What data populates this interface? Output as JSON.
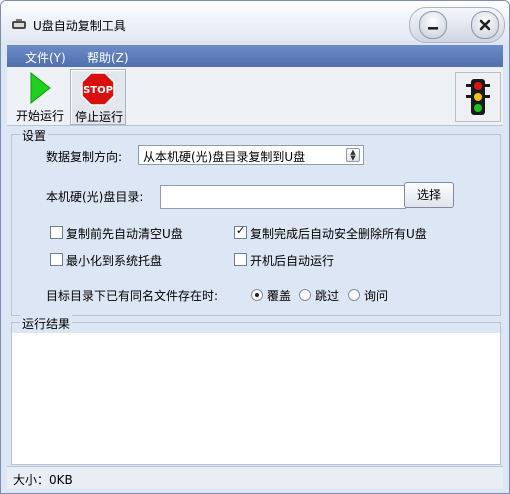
{
  "window": {
    "title": "U盘自动复制工具"
  },
  "menu": {
    "file": "文件(Y)",
    "help": "帮助(Z)"
  },
  "toolbar": {
    "start_label": "开始运行",
    "stop_label": "停止运行",
    "stop_sign_text": "STOP"
  },
  "settings": {
    "group_title": "设置",
    "direction_label": "数据复制方向:",
    "direction_value": "从本机硬(光)盘目录复制到U盘",
    "dir_label": "本机硬(光)盘目录:",
    "dir_value": "",
    "browse_button": "选择",
    "options": [
      {
        "label": "复制前先自动清空U盘",
        "checked": false
      },
      {
        "label": "复制完成后自动安全删除所有U盘",
        "checked": true
      },
      {
        "label": "最小化到系统托盘",
        "checked": false
      },
      {
        "label": "开机后自动运行",
        "checked": false
      }
    ],
    "conflict_label": "目标目录下已有同名文件存在时:",
    "conflict_options": [
      {
        "label": "覆盖",
        "selected": true
      },
      {
        "label": "跳过",
        "selected": false
      },
      {
        "label": "询问",
        "selected": false
      }
    ]
  },
  "results": {
    "title": "运行结果"
  },
  "status": {
    "size_text": "大小：0KB"
  },
  "colors": {
    "menubar": "#5a78b8",
    "window_bg": "#dde6f4",
    "play_green": "#1fcf1f",
    "stop_red": "#d81010"
  }
}
